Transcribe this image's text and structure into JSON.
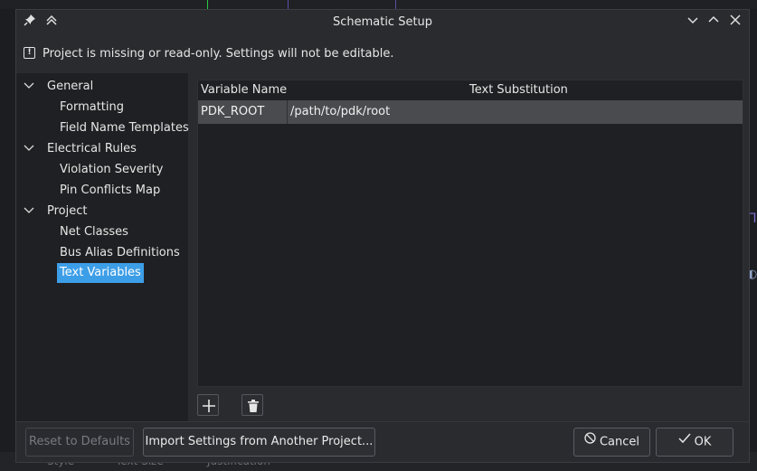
{
  "dialog": {
    "title": "Schematic Setup",
    "warning": "Project is missing or read-only. Settings will not be editable."
  },
  "tree": {
    "items": [
      {
        "label": "General",
        "level": 0,
        "expanded": true
      },
      {
        "label": "Formatting",
        "level": 1
      },
      {
        "label": "Field Name Templates",
        "level": 1
      },
      {
        "label": "Electrical Rules",
        "level": 0,
        "expanded": true
      },
      {
        "label": "Violation Severity",
        "level": 1
      },
      {
        "label": "Pin Conflicts Map",
        "level": 1
      },
      {
        "label": "Project",
        "level": 0,
        "expanded": true
      },
      {
        "label": "Net Classes",
        "level": 1
      },
      {
        "label": "Bus Alias Definitions",
        "level": 1
      },
      {
        "label": "Text Variables",
        "level": 1,
        "selected": true
      }
    ]
  },
  "grid": {
    "columns": [
      "Variable Name",
      "Text Substitution"
    ],
    "rows": [
      {
        "name": "PDK_ROOT",
        "value": "/path/to/pdk/root"
      }
    ]
  },
  "buttons": {
    "reset": "Reset to Defaults",
    "import": "Import Settings from Another Project...",
    "cancel": "Cancel",
    "ok": "OK"
  },
  "background": {
    "bottom_labels": [
      "Style",
      "Text Size",
      "Justification"
    ]
  },
  "colors": {
    "accent": "#3d9ee8",
    "dialog_bg": "#2a2b2f",
    "panel_bg": "#1f2023",
    "selected_row": "#4a4b4f"
  }
}
